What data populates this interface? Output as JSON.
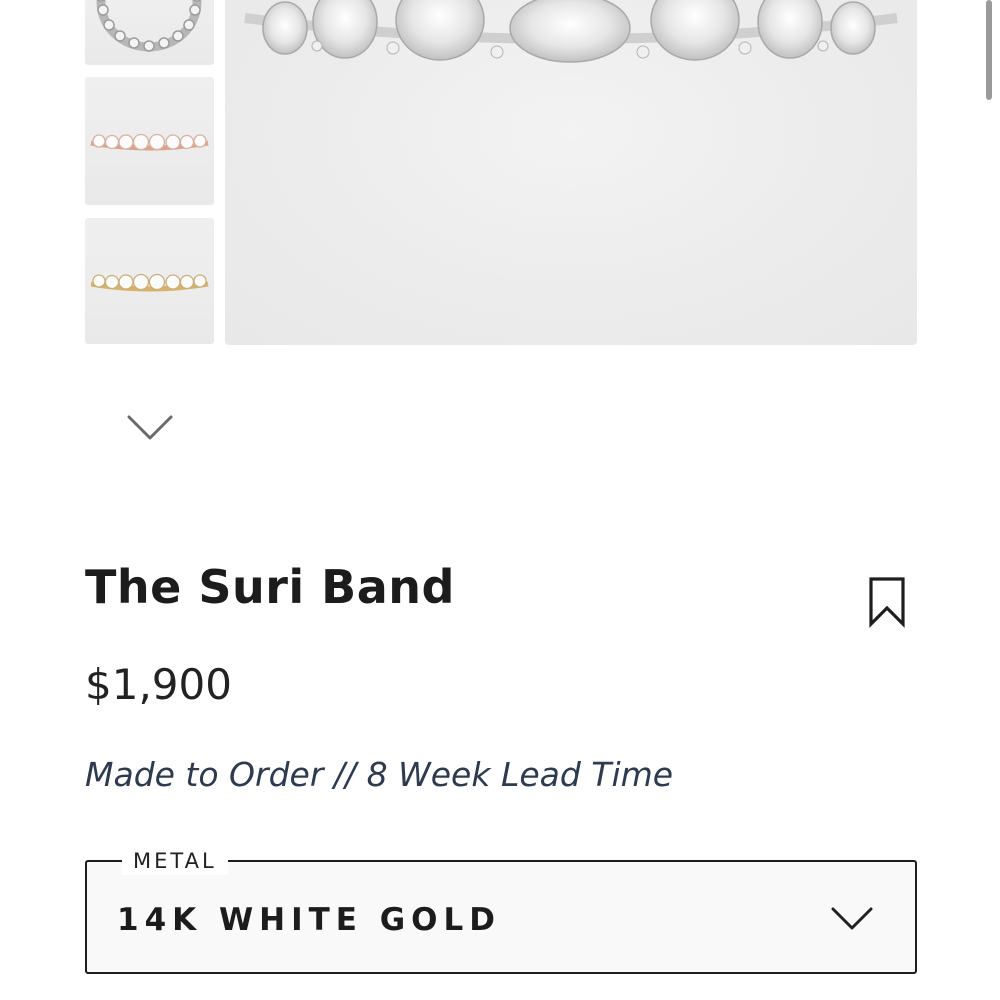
{
  "product": {
    "title": "The Suri Band",
    "price": "$1,900",
    "lead_time": "Made to Order // 8 Week Lead Time"
  },
  "gallery": {
    "thumbnails": [
      {
        "name": "white-gold-band-view",
        "metal": "white"
      },
      {
        "name": "rose-gold-band-view",
        "metal": "rose"
      },
      {
        "name": "yellow-gold-band-view",
        "metal": "yellow"
      }
    ],
    "down_icon": "chevron-down-icon"
  },
  "metal": {
    "label": "METAL",
    "selected": "14K WHITE GOLD",
    "icon": "chevron-down-icon"
  },
  "icons": {
    "bookmark": "bookmark-icon"
  },
  "colors": {
    "text_dark": "#1c1c1c",
    "lead_time": "#2e3a4e",
    "image_bg": "#ececec",
    "rose_gold": "#d9a48c",
    "yellow_gold": "#d8b26a",
    "white_gold": "#c9c9c9"
  }
}
